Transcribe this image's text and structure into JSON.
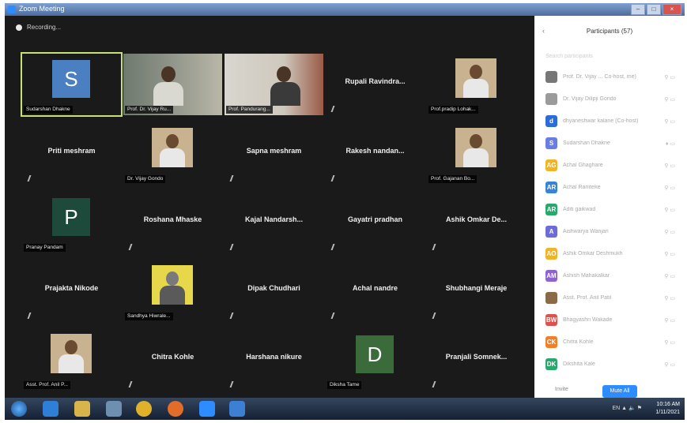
{
  "window": {
    "title": "Zoom Meeting",
    "controls": [
      "–",
      "□",
      "×"
    ]
  },
  "recording": {
    "label": "Recording..."
  },
  "tiles": [
    {
      "kind": "letter",
      "letter": "S",
      "color": "#4a7fc1",
      "label": "Sudarshan Dhakne",
      "active": true
    },
    {
      "kind": "video",
      "label": "Prof. Dr. Vijay Ru..."
    },
    {
      "kind": "video2",
      "label": "Prof. Pandurang..."
    },
    {
      "kind": "name",
      "name": "Rupali Ravindra..."
    },
    {
      "kind": "photo",
      "label": "Prof.pradip Lohak..."
    },
    {
      "kind": "name",
      "name": "Priti meshram"
    },
    {
      "kind": "photo",
      "label": "Dr. Vijay Gondo"
    },
    {
      "kind": "name",
      "name": "Sapna meshram"
    },
    {
      "kind": "name",
      "name": "Rakesh nandan..."
    },
    {
      "kind": "photo",
      "label": "Prof. Gajanan Bo..."
    },
    {
      "kind": "letter",
      "letter": "P",
      "color": "#1e4a3c",
      "label": "Pranay Pandam"
    },
    {
      "kind": "name",
      "name": "Roshana Mhaske"
    },
    {
      "kind": "name",
      "name": "Kajal  Nandarsh..."
    },
    {
      "kind": "name",
      "name": "Gayatri pradhan"
    },
    {
      "kind": "name",
      "name": "Ashik Omkar De..."
    },
    {
      "kind": "name",
      "name": "Prajakta Nikode"
    },
    {
      "kind": "cartoon",
      "label": "Sandhya Hiwrale..."
    },
    {
      "kind": "name",
      "name": "Dipak Chudhari"
    },
    {
      "kind": "name",
      "name": "Achal nandre"
    },
    {
      "kind": "name",
      "name": "Shubhangi Meraje"
    },
    {
      "kind": "photo",
      "label": "Asst. Prof. Anil P..."
    },
    {
      "kind": "name",
      "name": "Chitra Kohle"
    },
    {
      "kind": "name",
      "name": "Harshana nikure"
    },
    {
      "kind": "letter",
      "letter": "D",
      "color": "#3b6b3b",
      "label": "Diksha Tame"
    },
    {
      "kind": "name",
      "name": "Pranjali  Somnek..."
    }
  ],
  "panel": {
    "back": "‹",
    "title": "Participants (57)",
    "search": "Search participants",
    "participants": [
      {
        "initials": "",
        "color": "#777777",
        "name": "Prof. Dr. Vijay ... Co-host, me)",
        "icons": "⚲ ▭"
      },
      {
        "initials": "",
        "color": "#9b9b9b",
        "name": "Dr. Vijay Dilipji Gondo",
        "icons": "⚲ ▭"
      },
      {
        "initials": "d",
        "color": "#2d6bd6",
        "name": "dhyaneshwar kalane (Co-host)",
        "icons": "⚲ ▭"
      },
      {
        "initials": "S",
        "color": "#6a7de0",
        "name": "Sudarshan Dhakne",
        "icons": "♦ ▭"
      },
      {
        "initials": "AG",
        "color": "#f0b429",
        "name": "Achal Ghaghare",
        "icons": "⚲ ▭"
      },
      {
        "initials": "AR",
        "color": "#3a82d6",
        "name": "Achal Ramteke",
        "icons": "⚲ ▭"
      },
      {
        "initials": "AR",
        "color": "#2aa86b",
        "name": "Aditi gaikwad",
        "icons": "⚲ ▭"
      },
      {
        "initials": "A",
        "color": "#6c6cd8",
        "name": "Aishwarya Wanjari",
        "icons": "⚲ ▭"
      },
      {
        "initials": "AO",
        "color": "#f0b429",
        "name": "Ashik Omkar Deshmukh",
        "icons": "⚲ ▭"
      },
      {
        "initials": "AM",
        "color": "#8e63d1",
        "name": "Ashish Mahakalkar",
        "icons": "⚲ ▭"
      },
      {
        "initials": "",
        "color": "#8b6a4a",
        "name": "Asst. Prof. Anil Patil",
        "icons": "⚲ ▭"
      },
      {
        "initials": "BW",
        "color": "#d9534f",
        "name": "Bhagyashri Wakade",
        "icons": "⚲ ▭"
      },
      {
        "initials": "CK",
        "color": "#f07f29",
        "name": "Chitra Kohle",
        "icons": "⚲ ▭"
      },
      {
        "initials": "DK",
        "color": "#2aa86b",
        "name": "Dikshita Kale",
        "icons": "⚲ ▭"
      }
    ],
    "invite": "Invite",
    "unmute_all": "Mute All"
  },
  "taskbar": {
    "apps": [
      {
        "name": "ie",
        "color": "#2f7fd6"
      },
      {
        "name": "explorer",
        "color": "#d9b44a"
      },
      {
        "name": "media",
        "color": "#6f8fb0"
      },
      {
        "name": "chrome",
        "color": "#e0b22c"
      },
      {
        "name": "firefox",
        "color": "#e26d2b"
      },
      {
        "name": "zoom",
        "color": "#2d8cff"
      },
      {
        "name": "vlc",
        "color": "#3c7fd3"
      }
    ],
    "tray": "EN  ▲  🔈  ⚑",
    "time": "10:16 AM",
    "date": "1/11/2021"
  }
}
